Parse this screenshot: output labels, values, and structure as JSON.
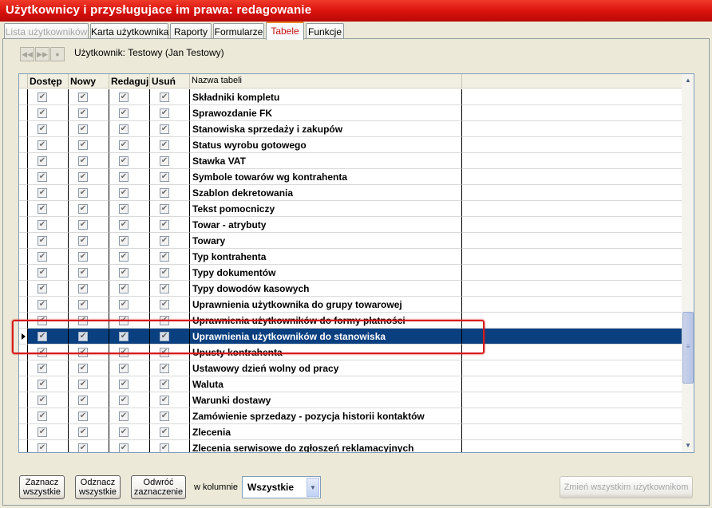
{
  "window": {
    "title": "Użytkownicy i przysługujace im prawa: redagowanie"
  },
  "tabs": [
    {
      "label": "Lista użytkowników",
      "disabled": true
    },
    {
      "label": "Karta użytkownika"
    },
    {
      "label": "Raporty"
    },
    {
      "label": "Formularze"
    },
    {
      "label": "Tabele",
      "active": true
    },
    {
      "label": "Funkcje"
    }
  ],
  "navigation": {
    "icons": [
      "rewind-icon",
      "fast-forward-icon",
      "record-icon"
    ]
  },
  "user_label": "Użytkownik: Testowy  (Jan Testowy)",
  "table": {
    "columns": [
      "Dostęp",
      "Nowy",
      "Redaguj",
      "Usuń",
      "Nazwa tabeli"
    ],
    "rows": [
      {
        "name": "Składniki kompletu"
      },
      {
        "name": "Sprawozdanie FK"
      },
      {
        "name": "Stanowiska sprzedaży i zakupów"
      },
      {
        "name": "Status wyrobu gotowego"
      },
      {
        "name": "Stawka VAT"
      },
      {
        "name": "Symbole towarów wg kontrahenta"
      },
      {
        "name": "Szablon dekretowania"
      },
      {
        "name": "Tekst pomocniczy"
      },
      {
        "name": "Towar - atrybuty"
      },
      {
        "name": "Towary"
      },
      {
        "name": "Typ kontrahenta"
      },
      {
        "name": "Typy dokumentów"
      },
      {
        "name": "Typy dowodów kasowych"
      },
      {
        "name": "Uprawnienia użytkownika do grupy towarowej"
      },
      {
        "name": "Uprawnienia użytkowników do formy płatności"
      },
      {
        "name": "Uprawnienia użytkowników do stanowiska",
        "selected": true
      },
      {
        "name": "Upusty kontrahenta"
      },
      {
        "name": "Ustawowy dzień wolny od pracy"
      },
      {
        "name": "Waluta"
      },
      {
        "name": "Warunki dostawy"
      },
      {
        "name": "Zamówienie sprzedazy - pozycja historii kontaktów"
      },
      {
        "name": "Zlecenia"
      },
      {
        "name": "Zlecenia serwisowe do zgłoszeń reklamacyjnych"
      }
    ],
    "checkbox_states": "all-checked"
  },
  "buttons": {
    "select_all": "Zaznacz wszystkie",
    "deselect_all": "Odznacz wszystkie",
    "invert_selection": "Odwróć zaznaczenie",
    "in_column_label": "w kolumnie",
    "column_select_value": "Wszystkie",
    "change_all_users": "Zmień wszystkim użytkownikom"
  },
  "colors": {
    "titlebar": "#d8100c",
    "selection": "#0a3f80",
    "active_tab_text": "#c0130f",
    "highlight_box": "#d61a1a"
  }
}
